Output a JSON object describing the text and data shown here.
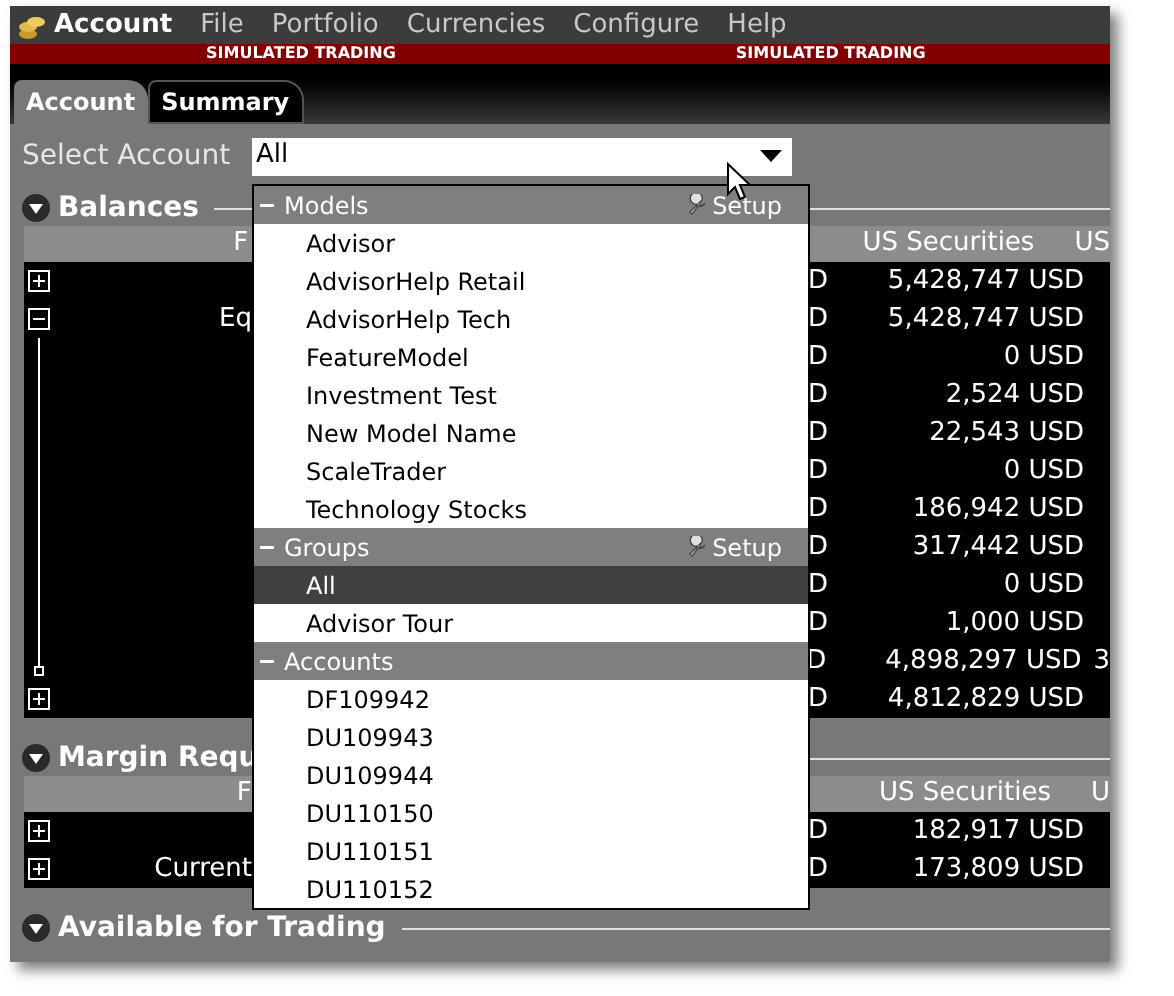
{
  "window": {
    "title": "Account"
  },
  "menu": [
    "File",
    "Portfolio",
    "Currencies",
    "Configure",
    "Help"
  ],
  "banner": [
    "SIMULATED TRADING",
    "SIMULATED TRADING"
  ],
  "tabs": [
    {
      "label": "Account",
      "selected": true
    },
    {
      "label": "Summary",
      "selected": false
    }
  ],
  "select_account": {
    "label": "Select Account",
    "value": "All"
  },
  "sections": [
    {
      "title": "Balances",
      "header": {
        "column_1": "F",
        "column_2": "US Securities",
        "column_3": "US"
      },
      "rows": [
        {
          "kind": "plus",
          "label": "",
          "column_1": "D",
          "value": "5,428,747 USD"
        },
        {
          "kind": "minus",
          "label": "Eq",
          "column_1": "D",
          "value": "5,428,747 USD"
        },
        {
          "kind": "branch",
          "label": "",
          "column_1": "D",
          "value": "0 USD"
        },
        {
          "kind": "branch",
          "label": "",
          "column_1": "D",
          "value": "2,524 USD"
        },
        {
          "kind": "branch",
          "label": "",
          "column_1": "D",
          "value": "22,543 USD"
        },
        {
          "kind": "branch",
          "label": "",
          "column_1": "D",
          "value": "0 USD"
        },
        {
          "kind": "branch",
          "label": "",
          "column_1": "D",
          "value": "186,942 USD"
        },
        {
          "kind": "branch",
          "label": "",
          "column_1": "D",
          "value": "317,442 USD"
        },
        {
          "kind": "branch",
          "label": "",
          "column_1": "D",
          "value": "0 USD"
        },
        {
          "kind": "branch",
          "label": "",
          "column_1": "D",
          "value": "1,000 USD"
        },
        {
          "kind": "end",
          "label": "",
          "column_1": "D",
          "value": "4,898,297 USD",
          "column_3": "3"
        },
        {
          "kind": "plus",
          "label": "",
          "column_1": "D",
          "value": "4,812,829 USD"
        }
      ]
    },
    {
      "title": "Margin Requ",
      "header": {
        "column_1": "F",
        "column_2": "US Securities",
        "column_3": "U"
      },
      "rows": [
        {
          "kind": "plus",
          "label": "",
          "column_1": "D",
          "value": "182,917 USD"
        },
        {
          "kind": "plus",
          "label": "Current",
          "column_1": "D",
          "value": "173,809 USD"
        }
      ]
    },
    {
      "title": "Available for Trading"
    }
  ],
  "dropdown": {
    "groups": [
      {
        "title": "Models",
        "setup": "Setup",
        "items": [
          {
            "label": "Advisor",
            "selected": false
          },
          {
            "label": "AdvisorHelp Retail",
            "selected": false
          },
          {
            "label": "AdvisorHelp Tech",
            "selected": false
          },
          {
            "label": "FeatureModel",
            "selected": false
          },
          {
            "label": "Investment Test",
            "selected": false
          },
          {
            "label": "New Model Name",
            "selected": false
          },
          {
            "label": "ScaleTrader",
            "selected": false
          },
          {
            "label": "Technology Stocks",
            "selected": false
          }
        ]
      },
      {
        "title": "Groups",
        "setup": "Setup",
        "items": [
          {
            "label": "All",
            "selected": true
          },
          {
            "label": "Advisor Tour",
            "selected": false
          }
        ]
      },
      {
        "title": "Accounts",
        "items": [
          {
            "label": "DF109942",
            "selected": false
          },
          {
            "label": "DU109943",
            "selected": false
          },
          {
            "label": "DU109944",
            "selected": false
          },
          {
            "label": "DU110150",
            "selected": false
          },
          {
            "label": "DU110151",
            "selected": false
          },
          {
            "label": "DU110152",
            "selected": false
          }
        ]
      }
    ]
  }
}
